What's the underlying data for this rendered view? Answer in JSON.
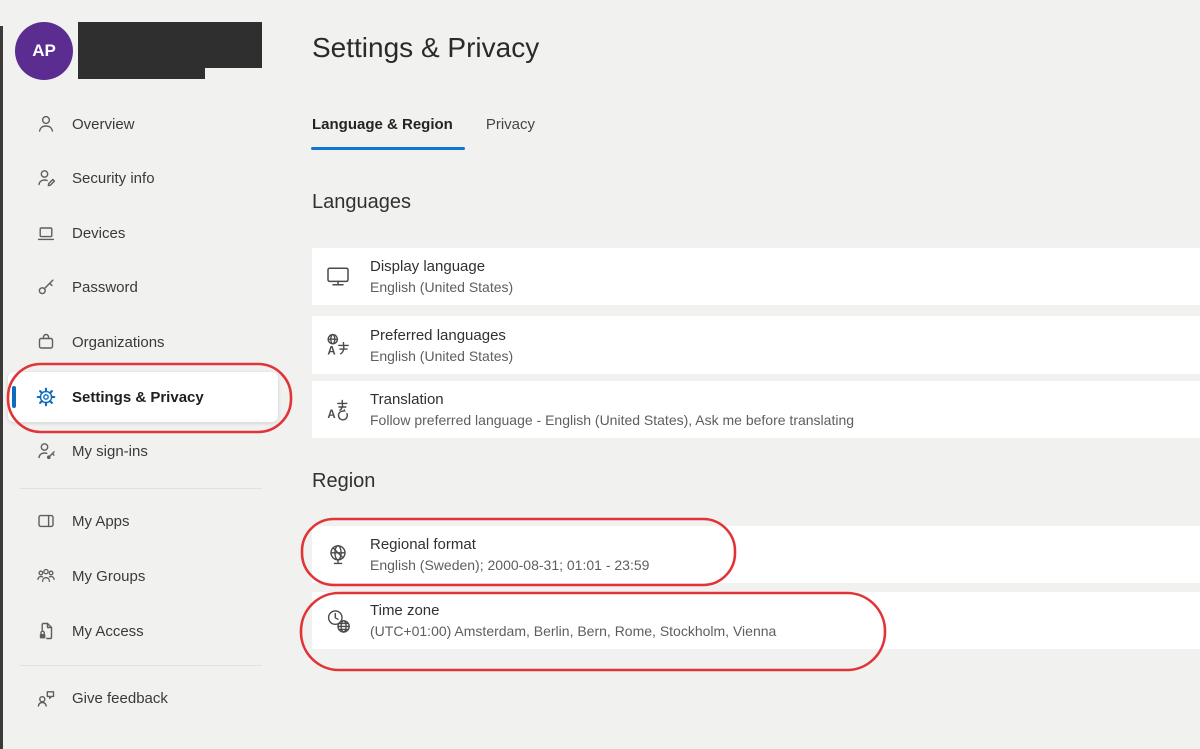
{
  "page": {
    "title": "Settings & Privacy"
  },
  "avatar": {
    "initials": "AP",
    "background": "#5c2d91"
  },
  "sidebar": {
    "items": [
      {
        "label": "Overview",
        "icon": "person-icon",
        "active": false
      },
      {
        "label": "Security info",
        "icon": "person-edit-icon",
        "active": false
      },
      {
        "label": "Devices",
        "icon": "laptop-icon",
        "active": false
      },
      {
        "label": "Password",
        "icon": "key-icon",
        "active": false
      },
      {
        "label": "Organizations",
        "icon": "briefcase-icon",
        "active": false
      },
      {
        "label": "Settings & Privacy",
        "icon": "gear-icon",
        "active": true
      },
      {
        "label": "My sign-ins",
        "icon": "person-key-icon",
        "active": false
      },
      {
        "label": "My Apps",
        "icon": "apps-window-icon",
        "active": false
      },
      {
        "label": "My Groups",
        "icon": "people-group-icon",
        "active": false
      },
      {
        "label": "My Access",
        "icon": "document-lock-icon",
        "active": false
      },
      {
        "label": "Give feedback",
        "icon": "person-feedback-icon",
        "active": false
      }
    ]
  },
  "tabs": {
    "items": [
      {
        "label": "Language & Region",
        "active": true
      },
      {
        "label": "Privacy",
        "active": false
      }
    ]
  },
  "sections": [
    {
      "heading": "Languages",
      "rows": [
        {
          "icon": "display-language-icon",
          "title": "Display language",
          "value": "English (United States)"
        },
        {
          "icon": "preferred-languages-icon",
          "title": "Preferred languages",
          "value": "English (United States)"
        },
        {
          "icon": "translation-icon",
          "title": "Translation",
          "value": "Follow preferred language - English (United States), Ask me before translating"
        }
      ]
    },
    {
      "heading": "Region",
      "rows": [
        {
          "icon": "regional-format-icon",
          "title": "Regional format",
          "value": "English (Sweden); 2000-08-31; 01:01 - 23:59",
          "annotated": true
        },
        {
          "icon": "time-zone-icon",
          "title": "Time zone",
          "value": "(UTC+01:00) Amsterdam, Berlin, Bern, Rome, Stockholm, Vienna",
          "annotated": true
        }
      ]
    }
  ],
  "colors": {
    "accent_blue": "#0f6cbd",
    "tab_underline_blue": "#1274d4",
    "annotation_red": "#e23438",
    "avatar_purple": "#5c2d91",
    "page_background": "#f1f1f0",
    "row_background": "#ffffff"
  }
}
